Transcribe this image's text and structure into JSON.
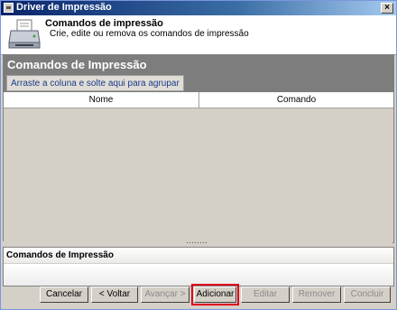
{
  "window": {
    "title": "Driver de Impressão",
    "close_label": "×"
  },
  "header": {
    "title": "Comandos de impressão",
    "subtitle": "Crie, edite ou remova os comandos de impressão",
    "icon": "printer-icon"
  },
  "panel": {
    "title": "Comandos de Impressão",
    "group_hint": "Arraste a coluna e solte aqui para agrupar",
    "columns": [
      "Nome",
      "Comando"
    ],
    "rows": []
  },
  "lower_panel": {
    "title": "Comandos de Impressão"
  },
  "buttons": {
    "cancel": "Cancelar",
    "back": "< Voltar",
    "next": "Avançar >",
    "add": "Adicionar",
    "edit": "Editar",
    "remove": "Remover",
    "finish": "Concluir"
  },
  "colors": {
    "highlight": "#e3001b",
    "panel_header": "#7d7d7d"
  }
}
